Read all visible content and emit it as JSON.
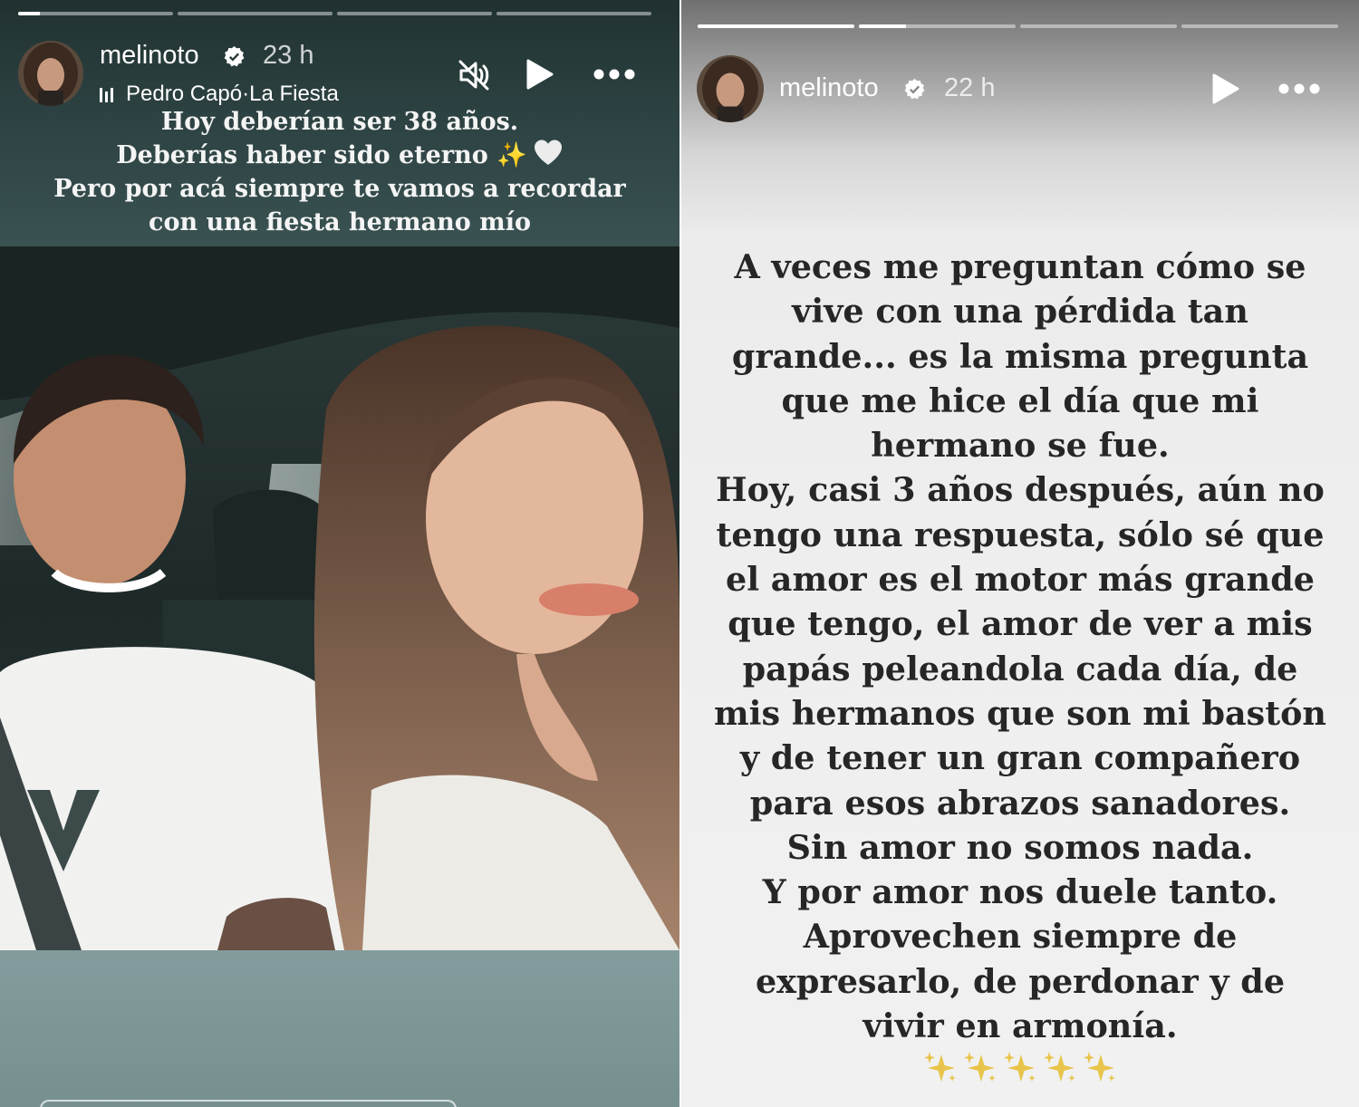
{
  "left_story": {
    "progress": [
      0.14,
      0,
      0,
      0
    ],
    "username": "melinoto",
    "time": "23 h",
    "music_artist": "Pedro Capó",
    "music_separator": " · ",
    "music_song": "La Fiesta",
    "caption_lines": [
      "Hoy deberían ser 38 años.",
      "Deberías haber sido eterno",
      "Pero por acá siempre te vamos a recordar",
      "con una fiesta hermano mío"
    ],
    "caption_emoji": "✨"
  },
  "right_story": {
    "progress": [
      1,
      0.3,
      0,
      0
    ],
    "username": "melinoto",
    "time": "22 h",
    "text_lines": [
      "A veces me preguntan cómo se",
      "vive con una pérdida tan",
      "grande... es la misma pregunta",
      "que me hice el día que mi",
      "hermano se fue.",
      "Hoy, casi 3 años después, aún no",
      "tengo una respuesta, sólo sé que",
      "el amor es el motor más grande",
      "que tengo, el amor de ver a mis",
      "papás peleandola cada día, de",
      "mis hermanos que son mi bastón",
      "y de tener un gran compañero",
      "para esos abrazos sanadores.",
      "Sin amor no somos nada.",
      "Y por amor nos duele tanto.",
      "Aprovechen siempre de",
      "expresarlo, de perdonar y de",
      "vivir en armonía."
    ],
    "sparkle_count": 5
  },
  "icons": {
    "mute": "muted-speaker-icon",
    "play": "play-icon",
    "more": "more-options-icon",
    "verified": "verified-badge-icon",
    "music": "music-bars-icon",
    "heart": "white-heart-icon",
    "sparkles": "sparkles-icon"
  },
  "colors": {
    "left_bg": "#7e9596",
    "caption_band": "#2f4444",
    "text_dark": "#262626",
    "sparkle": "#e8c44a"
  }
}
